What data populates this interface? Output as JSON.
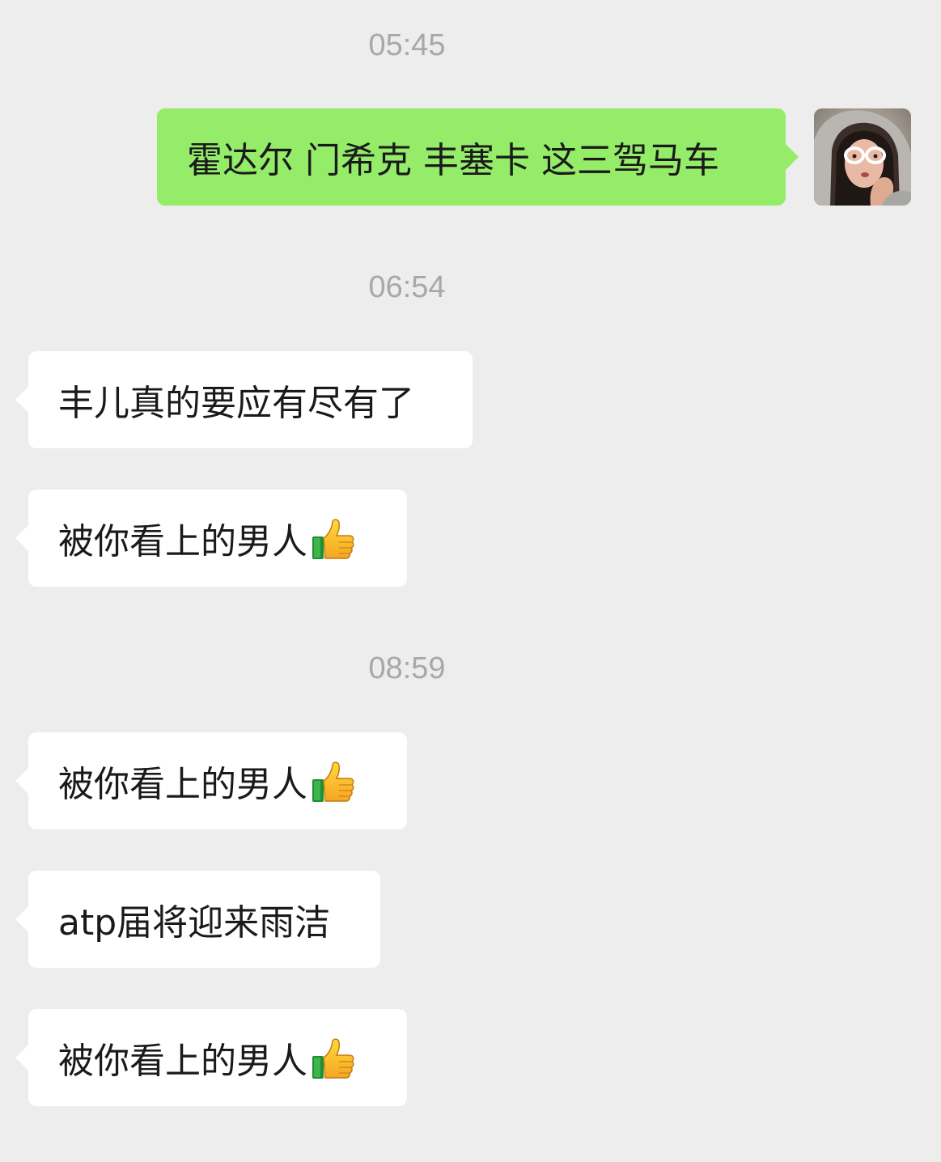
{
  "chat": {
    "timestamps": [
      "05:45",
      "06:54",
      "08:59"
    ],
    "outgoing": [
      {
        "text": "霍达尔 门希克 丰塞卡 这三驾马车"
      }
    ],
    "incoming": [
      {
        "text": "丰儿真的要应有尽有了",
        "emoji": ""
      },
      {
        "text": "被你看上的男人",
        "emoji": "thumbs-up"
      },
      {
        "text": "被你看上的男人",
        "emoji": "thumbs-up"
      },
      {
        "text": "atp届将迎来雨洁",
        "emoji": ""
      },
      {
        "text": "被你看上的男人",
        "emoji": "thumbs-up"
      }
    ]
  },
  "icons": {
    "emoji": "thumbs-up-icon",
    "avatar": "user-avatar"
  },
  "colors": {
    "background": "#ededed",
    "outgoing_bubble": "#95ec69",
    "incoming_bubble": "#ffffff",
    "timestamp": "#a8a8a8"
  }
}
